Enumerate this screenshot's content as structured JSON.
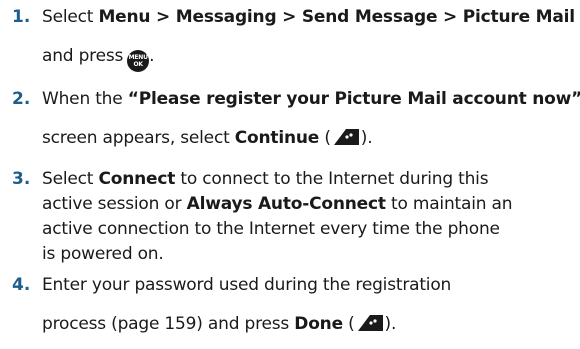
{
  "steps": [
    {
      "number": "1.",
      "l1_a": "Select ",
      "l1_b": "Menu > Messaging > Send Message > Picture Mail",
      "l2_a": "and press",
      "l2_key": "MENU\nOK",
      "l2_b": "."
    },
    {
      "number": "2.",
      "l1_a": "When the ",
      "l1_b": "“Please register your Picture Mail account now”",
      "l2_a": "screen appears, select ",
      "l2_b": "Continue",
      "l2_c": " (",
      "l2_d": ")."
    },
    {
      "number": "3.",
      "l1_a": "Select ",
      "l1_b": "Connect",
      "l1_c": " to connect to the Internet during this",
      "l2_a": "active session or ",
      "l2_b": "Always Auto-Connect",
      "l2_c": " to maintain an",
      "l3": "active connection to the Internet every time the phone",
      "l4": "is powered on."
    },
    {
      "number": "4.",
      "l1": "Enter your password used during the registration",
      "l2_a": "process (page 159) and press ",
      "l2_b": "Done",
      "l2_c": " (",
      "l2_d": ")."
    }
  ],
  "colors": {
    "step_number": "#1f5d8c",
    "text": "#1a1a1a"
  },
  "icons": {
    "menu_key": "menu-ok-key-icon",
    "softkey": "left-softkey-icon"
  }
}
